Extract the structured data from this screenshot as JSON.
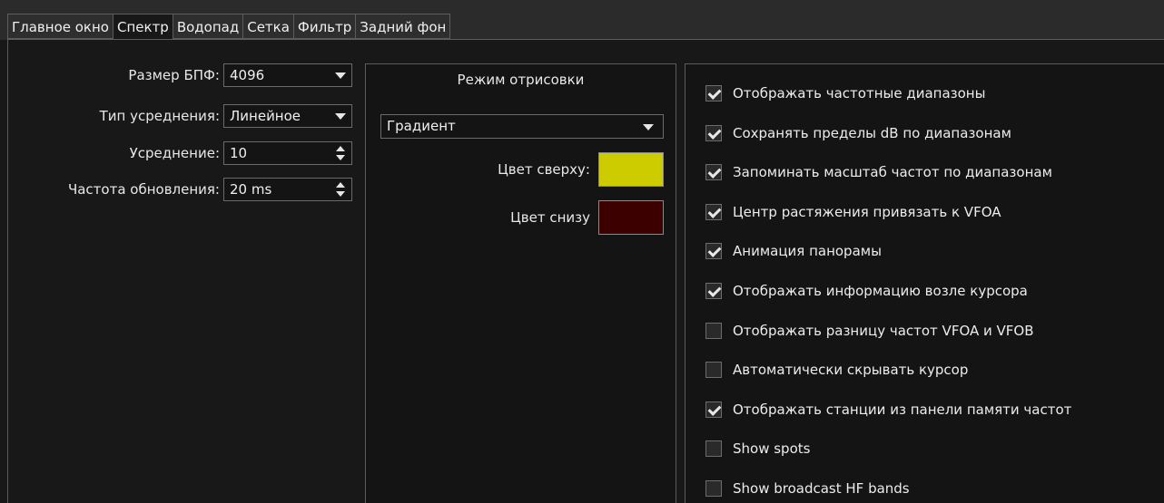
{
  "tabs": [
    {
      "label": "Главное окно",
      "active": false
    },
    {
      "label": "Спектр",
      "active": true
    },
    {
      "label": "Водопад",
      "active": false
    },
    {
      "label": "Сетка",
      "active": false
    },
    {
      "label": "Фильтр",
      "active": false
    },
    {
      "label": "Задний фон",
      "active": false
    }
  ],
  "spectrum_settings": {
    "fft_size": {
      "label": "Размер БПФ:",
      "value": "4096"
    },
    "averaging_type": {
      "label": "Тип усреднения:",
      "value": "Линейное"
    },
    "averaging": {
      "label": "Усреднение:",
      "value": "10"
    },
    "refresh_rate": {
      "label": "Частота обновления:",
      "value": "20 ms"
    }
  },
  "render_mode": {
    "title": "Режим отрисовки",
    "mode_value": "Градиент",
    "top_color_label": "Цвет сверху:",
    "top_color": "#cccc00",
    "bottom_color_label": "Цвет снизу",
    "bottom_color": "#3d0000"
  },
  "options": [
    {
      "label": "Отображать частотные диапазоны",
      "checked": true
    },
    {
      "label": "Сохранять пределы dB по диапазонам",
      "checked": true
    },
    {
      "label": "Запоминать масштаб частот по диапазонам",
      "checked": true
    },
    {
      "label": "Центр растяжения привязать к VFOA",
      "checked": true
    },
    {
      "label": "Анимация панорамы",
      "checked": true
    },
    {
      "label": "Отображать информацию возле курсора",
      "checked": true
    },
    {
      "label": "Отображать разницу частот VFOA и VFOB",
      "checked": false
    },
    {
      "label": "Автоматически скрывать курсор",
      "checked": false
    },
    {
      "label": "Отображать станции из панели памяти частот",
      "checked": true
    },
    {
      "label": "Show spots",
      "checked": false
    },
    {
      "label": "Show broadcast HF bands",
      "checked": false
    }
  ]
}
